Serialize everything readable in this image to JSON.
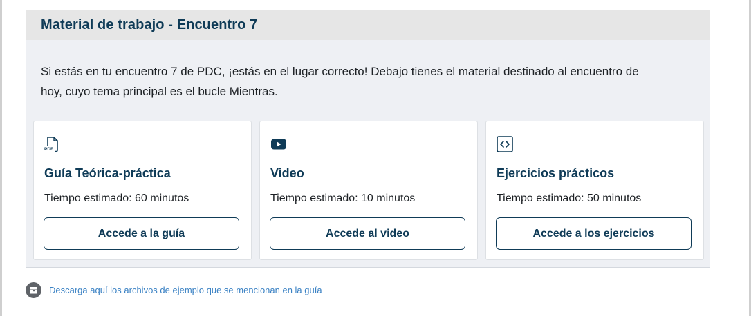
{
  "panel": {
    "title": "Material de trabajo - Encuentro 7",
    "intro": "Si estás en tu encuentro 7 de PDC, ¡estás en el lugar correcto! Debajo tienes el material destinado al encuentro de hoy, cuyo tema principal es el bucle Mientras."
  },
  "cards": [
    {
      "icon": "pdf-file-icon",
      "icon_text": "PDF",
      "title": "Guía Teórica-práctica",
      "time": "Tiempo estimado: 60 minutos",
      "button": "Accede a la guía"
    },
    {
      "icon": "video-play-icon",
      "title": "Video",
      "time": "Tiempo estimado: 10 minutos",
      "button": "Accede al video"
    },
    {
      "icon": "code-icon",
      "title": "Ejercicios prácticos",
      "time": "Tiempo estimado: 50 minutos",
      "button": "Accede a los ejercicios"
    }
  ],
  "download": {
    "icon": "archive-icon",
    "link": "Descarga aquí los archivos de ejemplo que se mencionan en la guía"
  },
  "colors": {
    "accent": "#0f3b57",
    "link": "#3b82c4",
    "panel_bg": "#eef0f4",
    "header_bg": "#e6e6e6"
  }
}
